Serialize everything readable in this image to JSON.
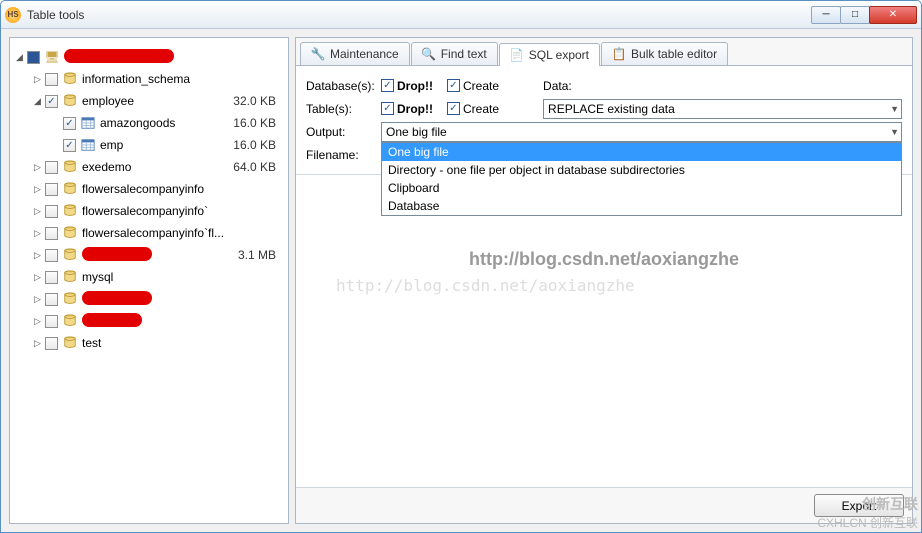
{
  "window": {
    "title": "Table tools"
  },
  "tree": {
    "root": {
      "label": "",
      "size": ""
    },
    "items": [
      {
        "indent": 1,
        "expander": "▷",
        "checked": false,
        "icon": "db",
        "label": "information_schema",
        "size": ""
      },
      {
        "indent": 1,
        "expander": "◢",
        "checked": true,
        "icon": "db",
        "label": "employee",
        "size": "32.0 KB"
      },
      {
        "indent": 2,
        "expander": "",
        "checked": true,
        "icon": "tbl",
        "label": "amazongoods",
        "size": "16.0 KB"
      },
      {
        "indent": 2,
        "expander": "",
        "checked": true,
        "icon": "tbl",
        "label": "emp",
        "size": "16.0 KB"
      },
      {
        "indent": 1,
        "expander": "▷",
        "checked": false,
        "icon": "db",
        "label": "exedemo",
        "size": "64.0 KB"
      },
      {
        "indent": 1,
        "expander": "▷",
        "checked": false,
        "icon": "db",
        "label": "flowersalecompanyinfo",
        "size": ""
      },
      {
        "indent": 1,
        "expander": "▷",
        "checked": false,
        "icon": "db",
        "label": "flowersalecompanyinfo`",
        "size": ""
      },
      {
        "indent": 1,
        "expander": "▷",
        "checked": false,
        "icon": "db",
        "label": "flowersalecompanyinfo`fl...",
        "size": ""
      },
      {
        "indent": 1,
        "expander": "▷",
        "checked": false,
        "icon": "db",
        "label": "",
        "redact": 70,
        "size": "3.1 MB"
      },
      {
        "indent": 1,
        "expander": "▷",
        "checked": false,
        "icon": "db",
        "label": "mysql",
        "size": ""
      },
      {
        "indent": 1,
        "expander": "▷",
        "checked": false,
        "icon": "db",
        "label": "",
        "redact": 70,
        "size": ""
      },
      {
        "indent": 1,
        "expander": "▷",
        "checked": false,
        "icon": "db",
        "label": "",
        "redact": 60,
        "size": ""
      },
      {
        "indent": 1,
        "expander": "▷",
        "checked": false,
        "icon": "db",
        "label": "test",
        "size": ""
      }
    ]
  },
  "tabs": [
    {
      "label": "Maintenance",
      "icon": "wrench"
    },
    {
      "label": "Find text",
      "icon": "find"
    },
    {
      "label": "SQL export",
      "icon": "sql",
      "active": true
    },
    {
      "label": "Bulk table editor",
      "icon": "bulk"
    }
  ],
  "form": {
    "databases_label": "Database(s):",
    "tables_label": "Table(s):",
    "drop_label": "Drop!!",
    "create_label": "Create",
    "data_label": "Data:",
    "data_combo": "REPLACE existing data",
    "output_label": "Output:",
    "output_combo": "One big file",
    "filename_label": "Filename:",
    "dropdown": [
      "One big file",
      "Directory - one file per object in database subdirectories",
      "Clipboard",
      "Database"
    ]
  },
  "watermark1": "http://blog.csdn.net/aoxiangzhe",
  "watermark2": "http://blog.csdn.net/aoxiangzhe",
  "export_label": "Export",
  "brand": {
    "line1": "创新互联",
    "line2": "CXHLCN 创新互联"
  }
}
